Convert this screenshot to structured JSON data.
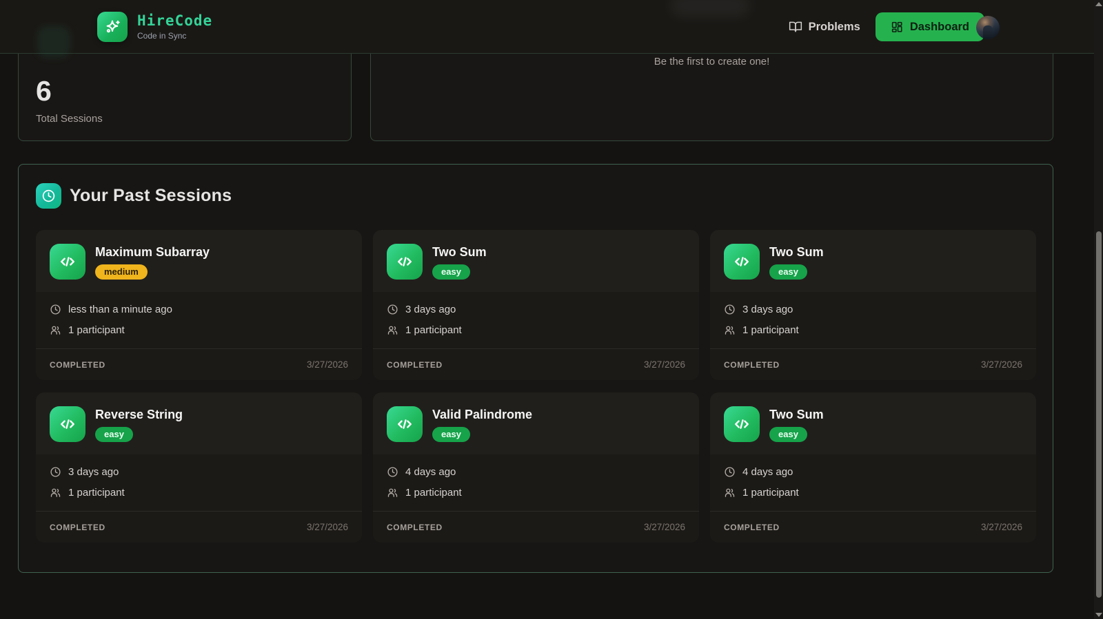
{
  "header": {
    "logo": {
      "title": "HireCode",
      "subtitle": "Code in Sync"
    },
    "nav": {
      "problems_label": "Problems",
      "dashboard_label": "Dashboard"
    }
  },
  "stats": {
    "total_sessions_value": "6",
    "total_sessions_label": "Total Sessions"
  },
  "empty_state": {
    "message": "Be the first to create one!"
  },
  "past_sessions": {
    "title": "Your Past Sessions",
    "cards": [
      {
        "title": "Maximum Subarray",
        "difficulty": "medium",
        "time_ago": "less than a minute ago",
        "participants": "1 participant",
        "status": "COMPLETED",
        "date": "3/27/2026"
      },
      {
        "title": "Two Sum",
        "difficulty": "easy",
        "time_ago": "3 days ago",
        "participants": "1 participant",
        "status": "COMPLETED",
        "date": "3/27/2026"
      },
      {
        "title": "Two Sum",
        "difficulty": "easy",
        "time_ago": "3 days ago",
        "participants": "1 participant",
        "status": "COMPLETED",
        "date": "3/27/2026"
      },
      {
        "title": "Reverse String",
        "difficulty": "easy",
        "time_ago": "3 days ago",
        "participants": "1 participant",
        "status": "COMPLETED",
        "date": "3/27/2026"
      },
      {
        "title": "Valid Palindrome",
        "difficulty": "easy",
        "time_ago": "4 days ago",
        "participants": "1 participant",
        "status": "COMPLETED",
        "date": "3/27/2026"
      },
      {
        "title": "Two Sum",
        "difficulty": "easy",
        "time_ago": "4 days ago",
        "participants": "1 participant",
        "status": "COMPLETED",
        "date": "3/27/2026"
      }
    ]
  },
  "icons": {
    "logo": "sparkle",
    "problems": "book-open",
    "dashboard": "layout-dashboard",
    "section_header": "clock",
    "session_card": "code-brackets",
    "time": "clock",
    "participants": "users"
  },
  "colors": {
    "brand_green": "#34d399",
    "button_green": "#25b24e",
    "badge_easy": "#16a34a",
    "badge_medium": "#f0b41c",
    "section_border": "#3e6252",
    "icon_gradient_start": "#38d993",
    "icon_gradient_end": "#16a34a",
    "page_background": "#151311",
    "card_background": "#1c1a17"
  }
}
